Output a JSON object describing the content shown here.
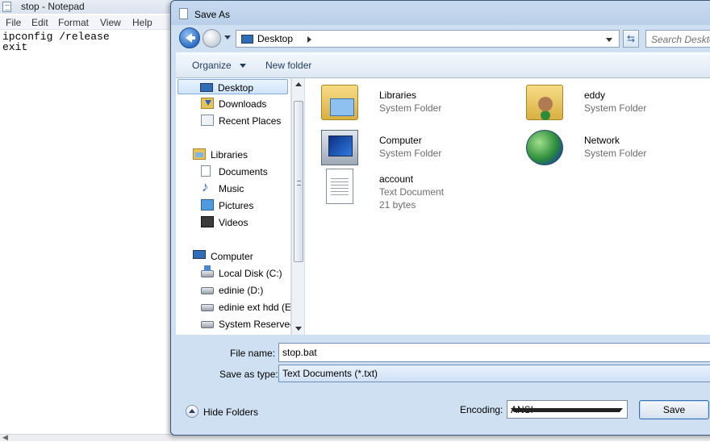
{
  "notepad": {
    "title": "stop - Notepad",
    "menu": [
      "File",
      "Edit",
      "Format",
      "View",
      "Help"
    ],
    "content_line1": "ipconfig /release",
    "content_line2": "exit"
  },
  "dialog": {
    "title": "Save As",
    "address": {
      "location": "Desktop"
    },
    "search_placeholder": "Search Desktop",
    "toolbar": {
      "organize": "Organize",
      "new_folder": "New folder"
    },
    "nav_items": [
      {
        "label": "Desktop",
        "icon": "desktop-icon"
      },
      {
        "label": "Downloads",
        "icon": "downloads-icon"
      },
      {
        "label": "Recent Places",
        "icon": "recent-places-icon"
      },
      {
        "label": "Libraries",
        "icon": "libraries-icon"
      },
      {
        "label": "Documents",
        "icon": "documents-icon"
      },
      {
        "label": "Music",
        "icon": "music-icon"
      },
      {
        "label": "Pictures",
        "icon": "pictures-icon"
      },
      {
        "label": "Videos",
        "icon": "videos-icon"
      },
      {
        "label": "Computer",
        "icon": "computer-icon"
      },
      {
        "label": "Local Disk (C:)",
        "icon": "local-disk-icon"
      },
      {
        "label": "edinie (D:)",
        "icon": "drive-icon"
      },
      {
        "label": "edinie ext hdd (E:",
        "icon": "drive-icon"
      },
      {
        "label": "System Reserved",
        "icon": "drive-icon"
      }
    ],
    "files": [
      {
        "name": "Libraries",
        "type": "System Folder",
        "icon": "libraries-folder-icon"
      },
      {
        "name": "eddy",
        "type": "System Folder",
        "icon": "user-folder-icon"
      },
      {
        "name": "Computer",
        "type": "System Folder",
        "icon": "computer-icon"
      },
      {
        "name": "Network",
        "type": "System Folder",
        "icon": "network-icon"
      },
      {
        "name": "account",
        "type": "Text Document",
        "size": "21 bytes",
        "icon": "text-document-icon"
      }
    ],
    "file_name_label": "File name:",
    "file_name_value": "stop.bat",
    "save_as_type_label": "Save as type:",
    "save_as_type_value": "Text Documents (*.txt)",
    "hide_folders": "Hide Folders",
    "encoding_label": "Encoding:",
    "encoding_value": "ANSI",
    "save_button": "Save"
  }
}
